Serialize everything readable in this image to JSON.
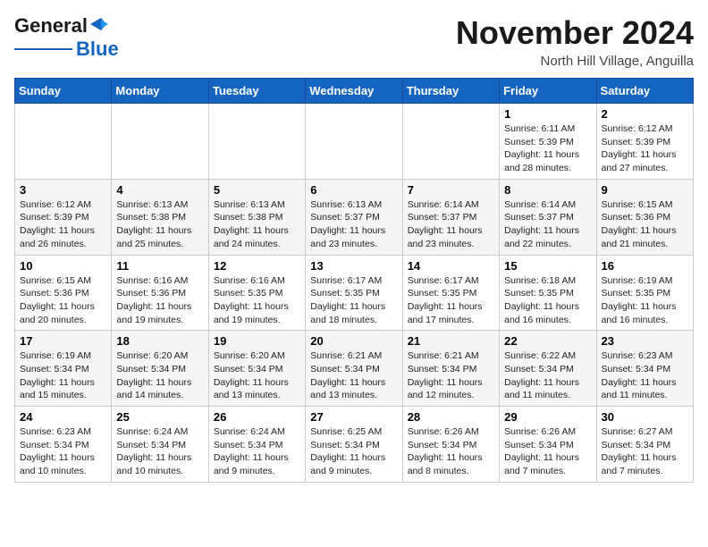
{
  "header": {
    "logo_line1": "General",
    "logo_line2": "Blue",
    "month": "November 2024",
    "location": "North Hill Village, Anguilla"
  },
  "weekdays": [
    "Sunday",
    "Monday",
    "Tuesday",
    "Wednesday",
    "Thursday",
    "Friday",
    "Saturday"
  ],
  "weeks": [
    [
      {
        "day": "",
        "info": ""
      },
      {
        "day": "",
        "info": ""
      },
      {
        "day": "",
        "info": ""
      },
      {
        "day": "",
        "info": ""
      },
      {
        "day": "",
        "info": ""
      },
      {
        "day": "1",
        "info": "Sunrise: 6:11 AM\nSunset: 5:39 PM\nDaylight: 11 hours\nand 28 minutes."
      },
      {
        "day": "2",
        "info": "Sunrise: 6:12 AM\nSunset: 5:39 PM\nDaylight: 11 hours\nand 27 minutes."
      }
    ],
    [
      {
        "day": "3",
        "info": "Sunrise: 6:12 AM\nSunset: 5:39 PM\nDaylight: 11 hours\nand 26 minutes."
      },
      {
        "day": "4",
        "info": "Sunrise: 6:13 AM\nSunset: 5:38 PM\nDaylight: 11 hours\nand 25 minutes."
      },
      {
        "day": "5",
        "info": "Sunrise: 6:13 AM\nSunset: 5:38 PM\nDaylight: 11 hours\nand 24 minutes."
      },
      {
        "day": "6",
        "info": "Sunrise: 6:13 AM\nSunset: 5:37 PM\nDaylight: 11 hours\nand 23 minutes."
      },
      {
        "day": "7",
        "info": "Sunrise: 6:14 AM\nSunset: 5:37 PM\nDaylight: 11 hours\nand 23 minutes."
      },
      {
        "day": "8",
        "info": "Sunrise: 6:14 AM\nSunset: 5:37 PM\nDaylight: 11 hours\nand 22 minutes."
      },
      {
        "day": "9",
        "info": "Sunrise: 6:15 AM\nSunset: 5:36 PM\nDaylight: 11 hours\nand 21 minutes."
      }
    ],
    [
      {
        "day": "10",
        "info": "Sunrise: 6:15 AM\nSunset: 5:36 PM\nDaylight: 11 hours\nand 20 minutes."
      },
      {
        "day": "11",
        "info": "Sunrise: 6:16 AM\nSunset: 5:36 PM\nDaylight: 11 hours\nand 19 minutes."
      },
      {
        "day": "12",
        "info": "Sunrise: 6:16 AM\nSunset: 5:35 PM\nDaylight: 11 hours\nand 19 minutes."
      },
      {
        "day": "13",
        "info": "Sunrise: 6:17 AM\nSunset: 5:35 PM\nDaylight: 11 hours\nand 18 minutes."
      },
      {
        "day": "14",
        "info": "Sunrise: 6:17 AM\nSunset: 5:35 PM\nDaylight: 11 hours\nand 17 minutes."
      },
      {
        "day": "15",
        "info": "Sunrise: 6:18 AM\nSunset: 5:35 PM\nDaylight: 11 hours\nand 16 minutes."
      },
      {
        "day": "16",
        "info": "Sunrise: 6:19 AM\nSunset: 5:35 PM\nDaylight: 11 hours\nand 16 minutes."
      }
    ],
    [
      {
        "day": "17",
        "info": "Sunrise: 6:19 AM\nSunset: 5:34 PM\nDaylight: 11 hours\nand 15 minutes."
      },
      {
        "day": "18",
        "info": "Sunrise: 6:20 AM\nSunset: 5:34 PM\nDaylight: 11 hours\nand 14 minutes."
      },
      {
        "day": "19",
        "info": "Sunrise: 6:20 AM\nSunset: 5:34 PM\nDaylight: 11 hours\nand 13 minutes."
      },
      {
        "day": "20",
        "info": "Sunrise: 6:21 AM\nSunset: 5:34 PM\nDaylight: 11 hours\nand 13 minutes."
      },
      {
        "day": "21",
        "info": "Sunrise: 6:21 AM\nSunset: 5:34 PM\nDaylight: 11 hours\nand 12 minutes."
      },
      {
        "day": "22",
        "info": "Sunrise: 6:22 AM\nSunset: 5:34 PM\nDaylight: 11 hours\nand 11 minutes."
      },
      {
        "day": "23",
        "info": "Sunrise: 6:23 AM\nSunset: 5:34 PM\nDaylight: 11 hours\nand 11 minutes."
      }
    ],
    [
      {
        "day": "24",
        "info": "Sunrise: 6:23 AM\nSunset: 5:34 PM\nDaylight: 11 hours\nand 10 minutes."
      },
      {
        "day": "25",
        "info": "Sunrise: 6:24 AM\nSunset: 5:34 PM\nDaylight: 11 hours\nand 10 minutes."
      },
      {
        "day": "26",
        "info": "Sunrise: 6:24 AM\nSunset: 5:34 PM\nDaylight: 11 hours\nand 9 minutes."
      },
      {
        "day": "27",
        "info": "Sunrise: 6:25 AM\nSunset: 5:34 PM\nDaylight: 11 hours\nand 9 minutes."
      },
      {
        "day": "28",
        "info": "Sunrise: 6:26 AM\nSunset: 5:34 PM\nDaylight: 11 hours\nand 8 minutes."
      },
      {
        "day": "29",
        "info": "Sunrise: 6:26 AM\nSunset: 5:34 PM\nDaylight: 11 hours\nand 7 minutes."
      },
      {
        "day": "30",
        "info": "Sunrise: 6:27 AM\nSunset: 5:34 PM\nDaylight: 11 hours\nand 7 minutes."
      }
    ]
  ]
}
